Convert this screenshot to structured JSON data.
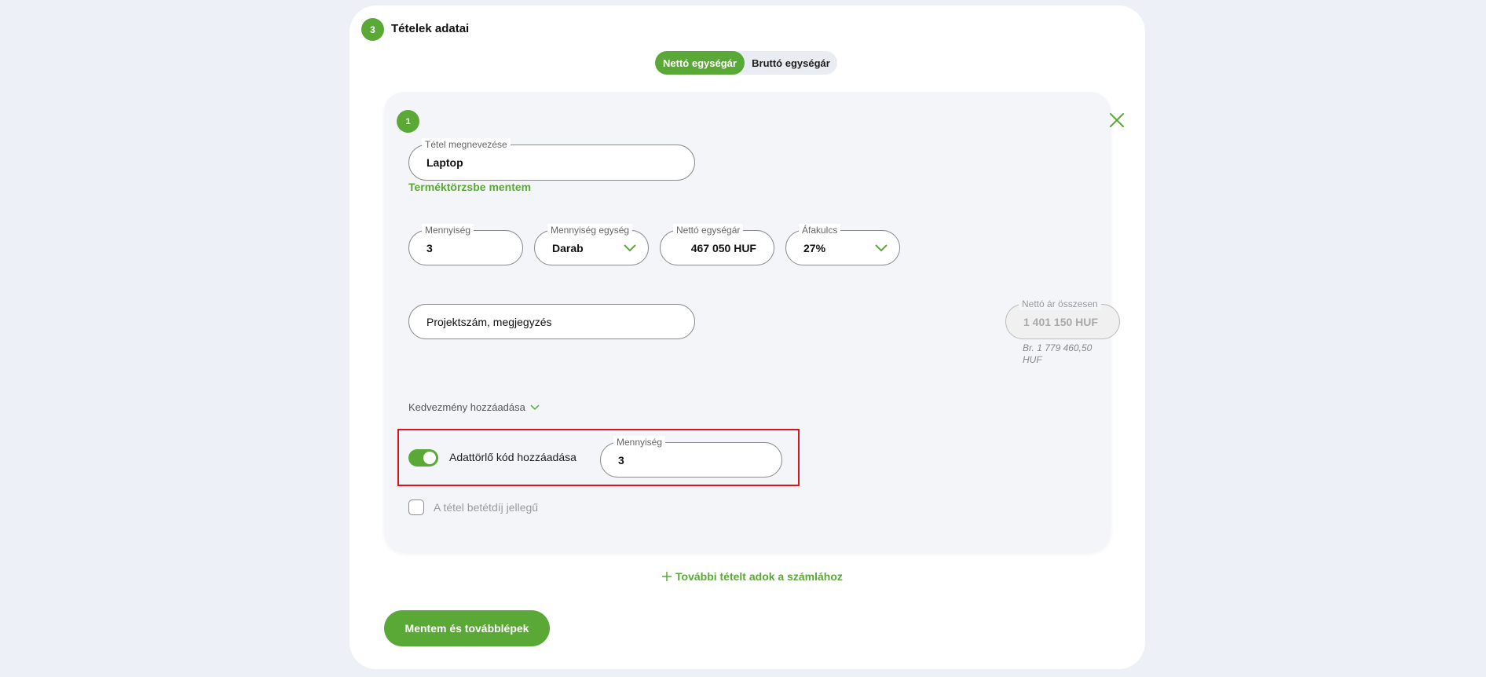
{
  "section": {
    "step": "3",
    "title": "Tételek adatai"
  },
  "price_toggle": {
    "net_label": "Nettó egységár",
    "gross_label": "Bruttó egységár",
    "active": "net"
  },
  "item": {
    "index": "1",
    "name": {
      "label": "Tétel megnevezése",
      "value": "Laptop"
    },
    "save_to_catalog": "Terméktörzsbe mentem",
    "quantity": {
      "label": "Mennyiség",
      "value": "3"
    },
    "unit": {
      "label": "Mennyiség egység",
      "value": "Darab"
    },
    "net_unit_price": {
      "label": "Nettó egységár",
      "value": "467 050 HUF"
    },
    "vat": {
      "label": "Áfakulcs",
      "value": "27%"
    },
    "project_note": {
      "placeholder": "Projektszám, megjegyzés"
    },
    "net_total": {
      "label": "Nettó ár összesen",
      "value": "1 401 150 HUF"
    },
    "gross_total": "Br. 1 779 460,50 HUF",
    "discount_label": "Kedvezmény hozzáadása",
    "data_delete": {
      "toggle_label": "Adattörlő kód hozzáadása",
      "enabled": true,
      "quantity_label": "Mennyiség",
      "quantity_value": "3"
    },
    "deposit_label": "A tétel betétdíj jellegű"
  },
  "add_more": "További tételt adok a számlához",
  "submit_label": "Mentem és továbblépek",
  "colors": {
    "brand_green": "#5aa936",
    "highlight_red": "#e0121f"
  }
}
